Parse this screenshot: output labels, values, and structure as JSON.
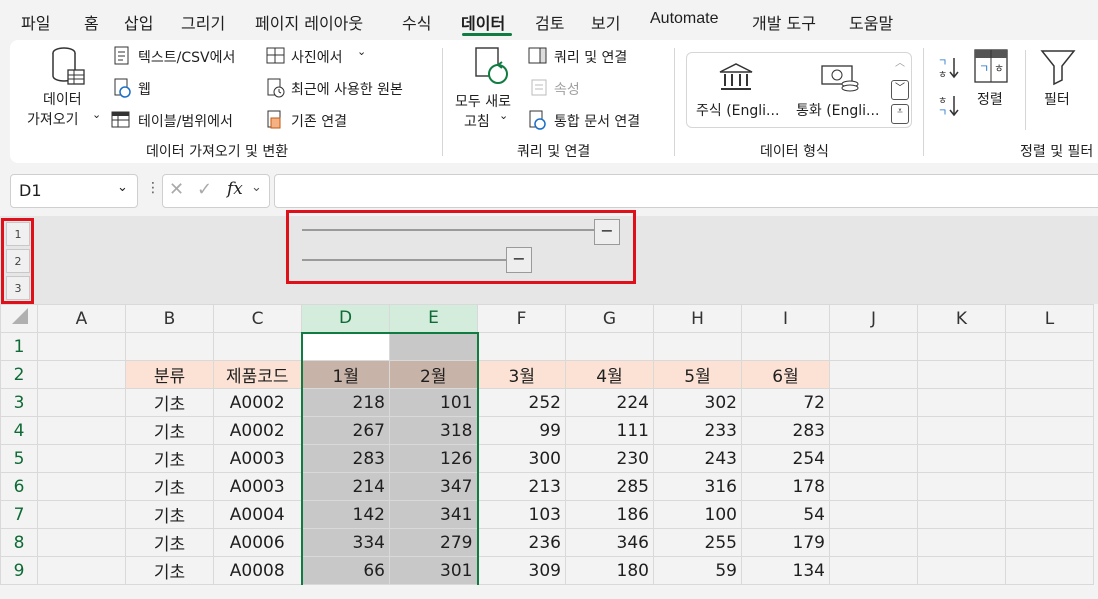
{
  "menu": {
    "tabs": [
      "파일",
      "홈",
      "삽입",
      "그리기",
      "페이지 레이아웃",
      "수식",
      "데이터",
      "검토",
      "보기",
      "Automate",
      "개발 도구",
      "도움말"
    ],
    "active": "데이터"
  },
  "ribbon": {
    "get_data": {
      "big_label_1": "데이터",
      "big_label_2": "가져오기",
      "text_csv": "텍스트/CSV에서",
      "web": "웹",
      "table_range": "테이블/범위에서",
      "from_picture": "사진에서",
      "recent_sources": "최근에 사용한 원본",
      "existing_connections": "기존 연결",
      "group": "데이터 가져오기 및 변환"
    },
    "queries": {
      "refresh_all_1": "모두 새로",
      "refresh_all_2": "고침",
      "queries_connections": "쿼리 및 연결",
      "properties": "속성",
      "edit_links": "통합 문서 연결",
      "group": "쿼리 및 연결"
    },
    "data_types": {
      "stocks": "주식 (Engli...",
      "currencies": "통화 (Engli...",
      "group": "데이터 형식"
    },
    "sort_filter": {
      "sort": "정렬",
      "filter": "필터",
      "group": "정렬 및 필터"
    }
  },
  "formula_bar": {
    "name_box": "D1",
    "fx": "fx",
    "content": ""
  },
  "outline": {
    "levels": [
      "1",
      "2",
      "3"
    ],
    "collapse_symbol": "−"
  },
  "sheet": {
    "columns": [
      "A",
      "B",
      "C",
      "D",
      "E",
      "F",
      "G",
      "H",
      "I",
      "J",
      "K",
      "L"
    ],
    "rows": [
      "1",
      "2",
      "3",
      "4",
      "5",
      "6",
      "7",
      "8",
      "9"
    ],
    "headers": [
      "분류",
      "제품코드",
      "1월",
      "2월",
      "3월",
      "4월",
      "5월",
      "6월"
    ],
    "data": [
      [
        "기초",
        "A0002",
        "218",
        "101",
        "252",
        "224",
        "302",
        "72"
      ],
      [
        "기초",
        "A0002",
        "267",
        "318",
        "99",
        "111",
        "233",
        "283"
      ],
      [
        "기초",
        "A0003",
        "283",
        "126",
        "300",
        "230",
        "243",
        "254"
      ],
      [
        "기초",
        "A0003",
        "214",
        "347",
        "213",
        "285",
        "316",
        "178"
      ],
      [
        "기초",
        "A0004",
        "142",
        "341",
        "103",
        "186",
        "100",
        "54"
      ],
      [
        "기초",
        "A0006",
        "334",
        "279",
        "236",
        "346",
        "255",
        "179"
      ],
      [
        "기초",
        "A0008",
        "66",
        "301",
        "309",
        "180",
        "59",
        "134"
      ]
    ]
  },
  "colors": {
    "accent_green": "#107c41",
    "highlight_red": "#e0101a",
    "header_fill": "#fbe2d5"
  }
}
